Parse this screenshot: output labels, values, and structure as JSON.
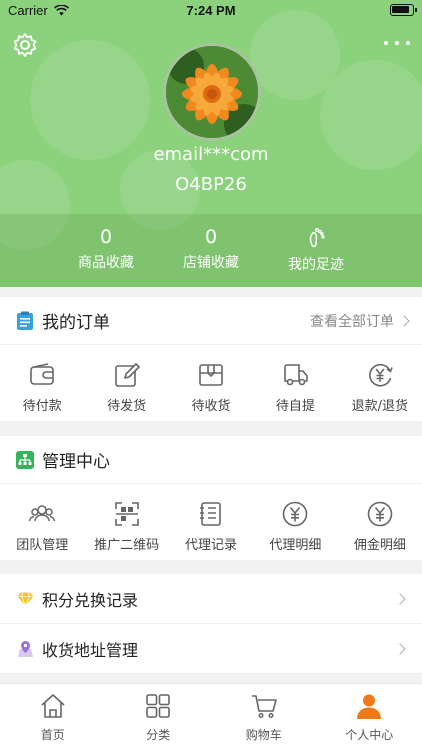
{
  "status_bar": {
    "carrier": "Carrier",
    "time": "7:24 PM"
  },
  "profile": {
    "email": "email***com",
    "code": "O4BP26"
  },
  "stats": [
    {
      "num": "0",
      "label": "商品收藏"
    },
    {
      "num": "0",
      "label": "店铺收藏"
    },
    {
      "label": "我的足迹"
    }
  ],
  "orders": {
    "title": "我的订单",
    "view_all": "查看全部订单",
    "items": [
      "待付款",
      "待发货",
      "待收货",
      "待自提",
      "退款/退货"
    ]
  },
  "management": {
    "title": "管理中心",
    "items": [
      "团队管理",
      "推广二维码",
      "代理记录",
      "代理明细",
      "佣金明细"
    ]
  },
  "menu": {
    "points": "积分兑换记录",
    "address": "收货地址管理"
  },
  "tabbar": [
    "首页",
    "分类",
    "购物车",
    "个人中心"
  ],
  "colors": {
    "header_green": "#8cd27d",
    "accent_orange": "#f07a1a"
  }
}
